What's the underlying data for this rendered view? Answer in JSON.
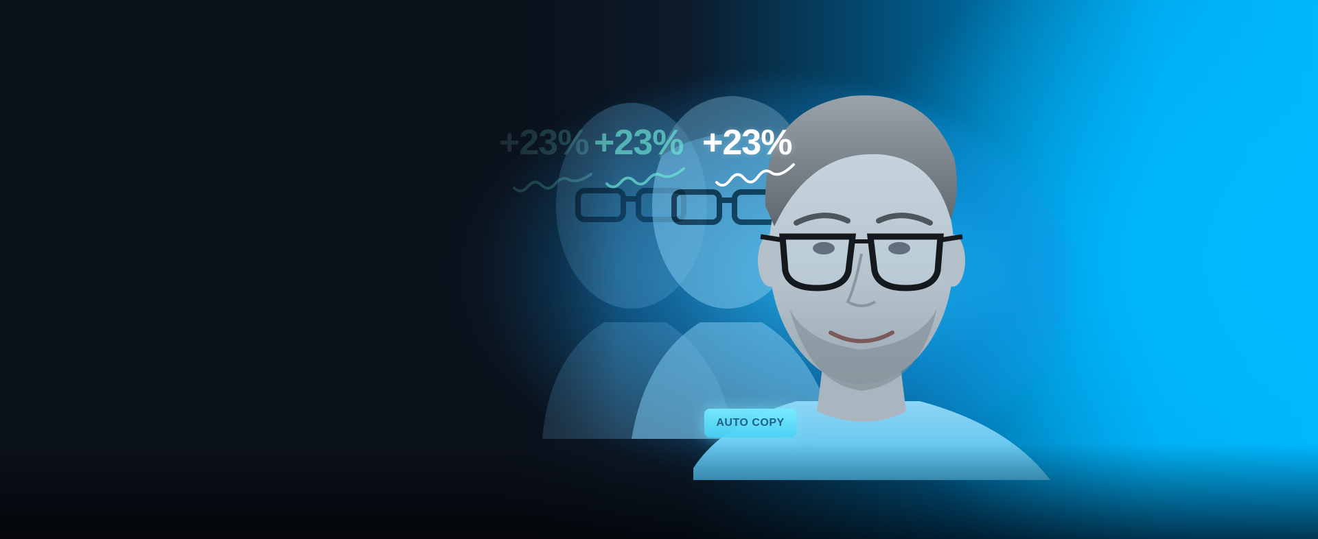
{
  "hero": {
    "stat_far": "+23%",
    "stat_mid": "+23%",
    "stat_front": "+23%",
    "chip_label": "AUTO COPY"
  },
  "colors": {
    "background_dark": "#0b111b",
    "accent_blue": "#00b7fb",
    "stat_teal": "#6fe6d7",
    "chip_bg": "#6fdcf6",
    "chip_text": "#1d5f86"
  },
  "icons": {
    "trend": "squiggle-trend-icon"
  }
}
